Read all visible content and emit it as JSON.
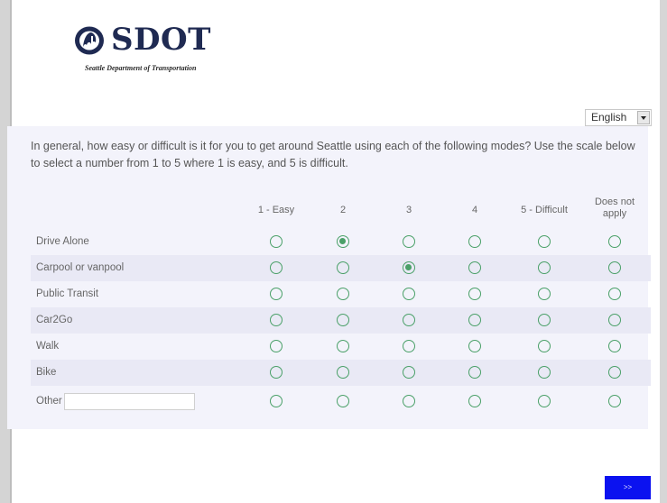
{
  "logo": {
    "name": "SDOT",
    "tagline": "Seattle Department of Transportation",
    "brand_color": "#1f2a52",
    "icon": "seattle-seal-icon"
  },
  "language": {
    "selected": "English"
  },
  "question": "In general, how easy or difficult is it for you to get around Seattle using each of the following modes? Use the scale below to select a number from 1 to 5 where 1 is easy, and 5 is difficult.",
  "columns": [
    "1 - Easy",
    "2",
    "3",
    "4",
    "5 - Difficult",
    "Does not apply"
  ],
  "rows": [
    {
      "label": "Drive Alone",
      "selected": "2"
    },
    {
      "label": "Carpool or vanpool",
      "selected": "3"
    },
    {
      "label": "Public Transit",
      "selected": null
    },
    {
      "label": "Car2Go",
      "selected": null
    },
    {
      "label": "Walk",
      "selected": null
    },
    {
      "label": "Bike",
      "selected": null
    },
    {
      "label": "Other",
      "selected": null,
      "input_value": ""
    }
  ],
  "next_button": {
    "label": ">>"
  },
  "colors": {
    "radio": "#4aa068",
    "panel_bg": "#f3f3fb",
    "row_shade": "#e9e9f5",
    "button_bg": "#0b12f0"
  }
}
